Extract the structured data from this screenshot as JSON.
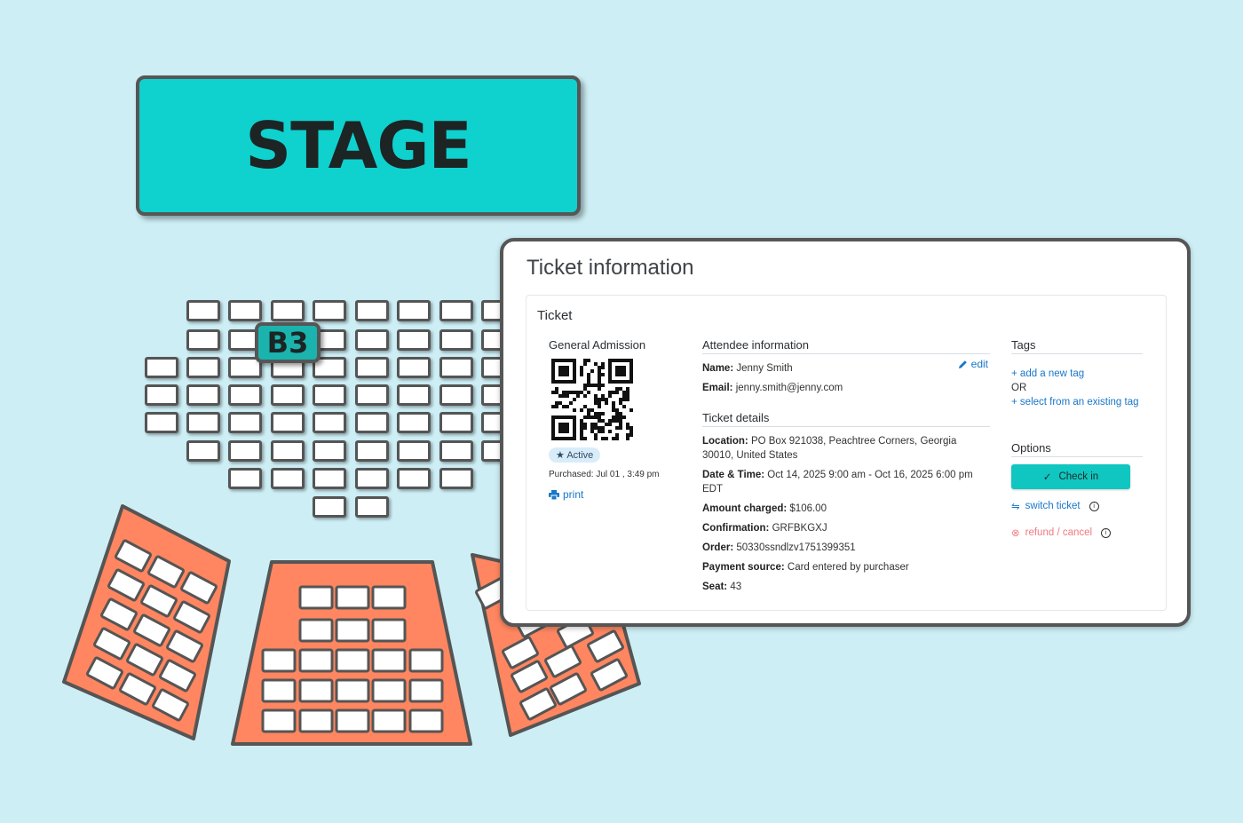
{
  "stage": {
    "label": "STAGE"
  },
  "selected_seat": {
    "label": "B3"
  },
  "ticket_panel": {
    "title": "Ticket information",
    "section_title": "Ticket",
    "ticket_type": "General Admission",
    "status": "Active",
    "purchased": "Purchased: Jul 01 , 3:49 pm",
    "print_label": "print",
    "attendee": {
      "heading": "Attendee information",
      "edit_label": "edit",
      "name_label": "Name:",
      "name": "Jenny Smith",
      "email_label": "Email:",
      "email": "jenny.smith@jenny.com"
    },
    "details": {
      "heading": "Ticket details",
      "location_label": "Location:",
      "location": "PO Box 921038, Peachtree Corners, Georgia 30010, United States",
      "datetime_label": "Date & Time:",
      "datetime": "Oct 14, 2025 9:00 am - Oct 16, 2025 6:00 pm EDT",
      "amount_label": "Amount charged:",
      "amount": "$106.00",
      "confirmation_label": "Confirmation:",
      "confirmation": "GRFBKGXJ",
      "order_label": "Order:",
      "order": "50330ssndlzv1751399351",
      "payment_label": "Payment source:",
      "payment": "Card entered by purchaser",
      "seat_label": "Seat:",
      "seat": "43"
    },
    "tags": {
      "heading": "Tags",
      "add_new": "add a new tag",
      "or": "OR",
      "select_existing": "select from an existing tag"
    },
    "options": {
      "heading": "Options",
      "checkin_label": "Check in",
      "switch_label": "switch ticket",
      "refund_label": "refund / cancel"
    }
  },
  "colors": {
    "background": "#cdeef5",
    "stage": "#0fd1ce",
    "section_orange": "#ff8660",
    "checkin_button": "#10c6c0",
    "link": "#1877c9",
    "refund": "#f07a80"
  }
}
